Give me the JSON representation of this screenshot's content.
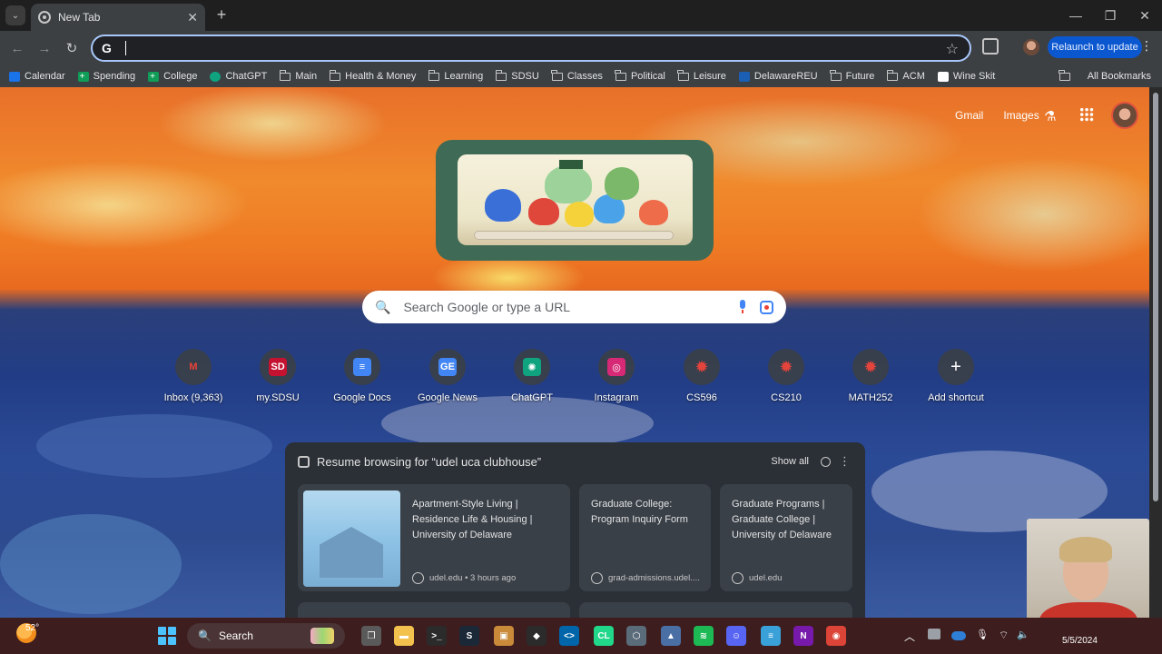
{
  "browser": {
    "tab_title": "New Tab",
    "tab_search_glyph": "⌄",
    "tab_close_glyph": "✕",
    "new_tab_glyph": "+",
    "window_controls": {
      "minimize": "—",
      "maximize": "❐",
      "close": "✕"
    },
    "toolbar": {
      "back_glyph": "←",
      "forward_glyph": "→",
      "reload_glyph": "↻",
      "omnibox_glyph": "G",
      "star_glyph": "☆",
      "relaunch_label": "Relaunch to update",
      "menu_glyph": "⋮"
    },
    "bookmarks": [
      {
        "label": "Calendar",
        "icon": "calendar-icon",
        "kind": "cal"
      },
      {
        "label": "Spending",
        "icon": "sheets-icon",
        "kind": "sheet"
      },
      {
        "label": "College",
        "icon": "sheets-icon",
        "kind": "sheet"
      },
      {
        "label": "ChatGPT",
        "icon": "chatgpt-icon",
        "kind": "gpt"
      },
      {
        "label": "Main",
        "icon": "folder-icon",
        "kind": "folder"
      },
      {
        "label": "Health & Money",
        "icon": "folder-icon",
        "kind": "folder"
      },
      {
        "label": "Learning",
        "icon": "folder-icon",
        "kind": "folder"
      },
      {
        "label": "SDSU",
        "icon": "folder-icon",
        "kind": "folder"
      },
      {
        "label": "Classes",
        "icon": "folder-icon",
        "kind": "folder"
      },
      {
        "label": "Political",
        "icon": "folder-icon",
        "kind": "folder"
      },
      {
        "label": "Leisure",
        "icon": "folder-icon",
        "kind": "folder"
      },
      {
        "label": "DelawareREU",
        "icon": "udel-icon",
        "kind": "ud"
      },
      {
        "label": "Future",
        "icon": "folder-icon",
        "kind": "folder"
      },
      {
        "label": "ACM",
        "icon": "folder-icon",
        "kind": "folder"
      },
      {
        "label": "Wine Skit",
        "icon": "notion-icon",
        "kind": "wine"
      }
    ],
    "all_bookmarks_label": "All Bookmarks"
  },
  "ntp": {
    "top_links": {
      "gmail": "Gmail",
      "images": "Images"
    },
    "labs_glyph": "⚗",
    "search_glyph": "🔍",
    "search_placeholder": "Search Google or type a URL",
    "shortcuts": [
      {
        "label": "Inbox (9,363)",
        "icon": "gmail-icon",
        "glyph": "M",
        "color": "#ea4335",
        "bg": "transparent"
      },
      {
        "label": "my.SDSU",
        "icon": "sdsu-icon",
        "glyph": "SD",
        "color": "#ffffff",
        "bg": "#c41230"
      },
      {
        "label": "Google Docs",
        "icon": "google-docs-icon",
        "glyph": "≡",
        "color": "#ffffff",
        "bg": "#4285f4"
      },
      {
        "label": "Google News",
        "icon": "google-news-icon",
        "glyph": "GE",
        "color": "#ffffff",
        "bg": "#4285f4"
      },
      {
        "label": "ChatGPT",
        "icon": "chatgpt-icon",
        "glyph": "✺",
        "color": "#ffffff",
        "bg": "#10a37f"
      },
      {
        "label": "Instagram",
        "icon": "instagram-icon",
        "glyph": "◎",
        "color": "#ffffff",
        "bg": "#d62976"
      },
      {
        "label": "CS596",
        "icon": "canvas-icon",
        "glyph": "✹",
        "color": "#e4443b",
        "bg": "transparent"
      },
      {
        "label": "CS210",
        "icon": "canvas-icon",
        "glyph": "✹",
        "color": "#e4443b",
        "bg": "transparent"
      },
      {
        "label": "MATH252",
        "icon": "canvas-icon",
        "glyph": "✹",
        "color": "#e4443b",
        "bg": "transparent"
      },
      {
        "label": "Add shortcut",
        "icon": "plus-icon",
        "glyph": "+",
        "color": "#ffffff",
        "bg": "transparent"
      }
    ],
    "resume": {
      "title": "Resume browsing for “udel uca clubhouse”",
      "show_all": "Show all",
      "more_glyph": "⋮",
      "cards": [
        {
          "title": "Apartment-Style Living | Residence Life & Housing | University of Delaware",
          "source": "udel.edu • 3 hours ago"
        },
        {
          "title": "Graduate College: Program Inquiry Form",
          "source": "grad-admissions.udel...."
        },
        {
          "title": "Graduate Programs | Graduate College | University of Delaware",
          "source": "udel.edu"
        }
      ]
    }
  },
  "taskbar": {
    "weather_temp": "52°",
    "search_label": "Search",
    "search_glyph": "🔍",
    "apps": [
      {
        "name": "task-view-icon",
        "glyph": "❐",
        "bg": "#5a5a5a"
      },
      {
        "name": "file-explorer-icon",
        "glyph": "▬",
        "bg": "#f2c14e"
      },
      {
        "name": "terminal-icon",
        "glyph": ">_",
        "bg": "#2b2b2b"
      },
      {
        "name": "steam-icon",
        "glyph": "S",
        "bg": "#1b2838"
      },
      {
        "name": "package-icon",
        "glyph": "▣",
        "bg": "#c98a3a"
      },
      {
        "name": "alienware-icon",
        "glyph": "◆",
        "bg": "#2b2b2b"
      },
      {
        "name": "vscode-icon",
        "glyph": "<>",
        "bg": "#0065a9"
      },
      {
        "name": "clion-icon",
        "glyph": "CL",
        "bg": "#21d789"
      },
      {
        "name": "virtualbox-icon",
        "glyph": "⬡",
        "bg": "#5a6b7a"
      },
      {
        "name": "photos-icon",
        "glyph": "▲",
        "bg": "#4a6fa5"
      },
      {
        "name": "spotify-icon",
        "glyph": "≋",
        "bg": "#1db954"
      },
      {
        "name": "discord-icon",
        "glyph": "☺",
        "bg": "#5865f2"
      },
      {
        "name": "notepad-icon",
        "glyph": "≡",
        "bg": "#3aa0d8"
      },
      {
        "name": "onenote-icon",
        "glyph": "N",
        "bg": "#7719aa"
      },
      {
        "name": "chrome-icon",
        "glyph": "◉",
        "bg": "#db4437"
      }
    ],
    "tray_glyphs": {
      "chevron": "︿",
      "mic": "🎙",
      "wifi": "⌔",
      "volume": "🔈"
    },
    "date": "5/5/2024"
  }
}
